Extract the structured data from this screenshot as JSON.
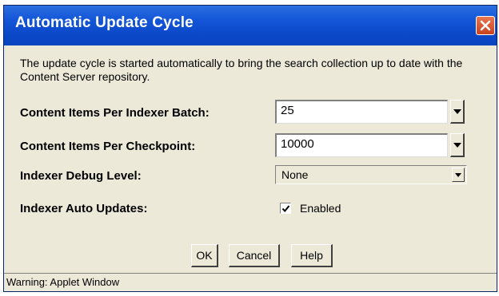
{
  "window": {
    "title": "Automatic Update Cycle"
  },
  "description": "The update cycle is started automatically to bring the search collection up to date with the Content Server repository.",
  "fields": {
    "batch": {
      "label": "Content Items Per Indexer Batch:",
      "value": "25"
    },
    "checkpoint": {
      "label": "Content Items Per Checkpoint:",
      "value": "10000"
    },
    "debug": {
      "label": "Indexer Debug Level:",
      "value": "None"
    },
    "auto_updates": {
      "label": "Indexer Auto Updates:",
      "checkbox_label": "Enabled",
      "checked": true
    }
  },
  "buttons": {
    "ok": "OK",
    "cancel": "Cancel",
    "help": "Help"
  },
  "status": "Warning: Applet Window",
  "colors": {
    "title_bar": "#0b49c9",
    "close_button": "#d9532f",
    "dialog_bg": "#ece9d8"
  }
}
